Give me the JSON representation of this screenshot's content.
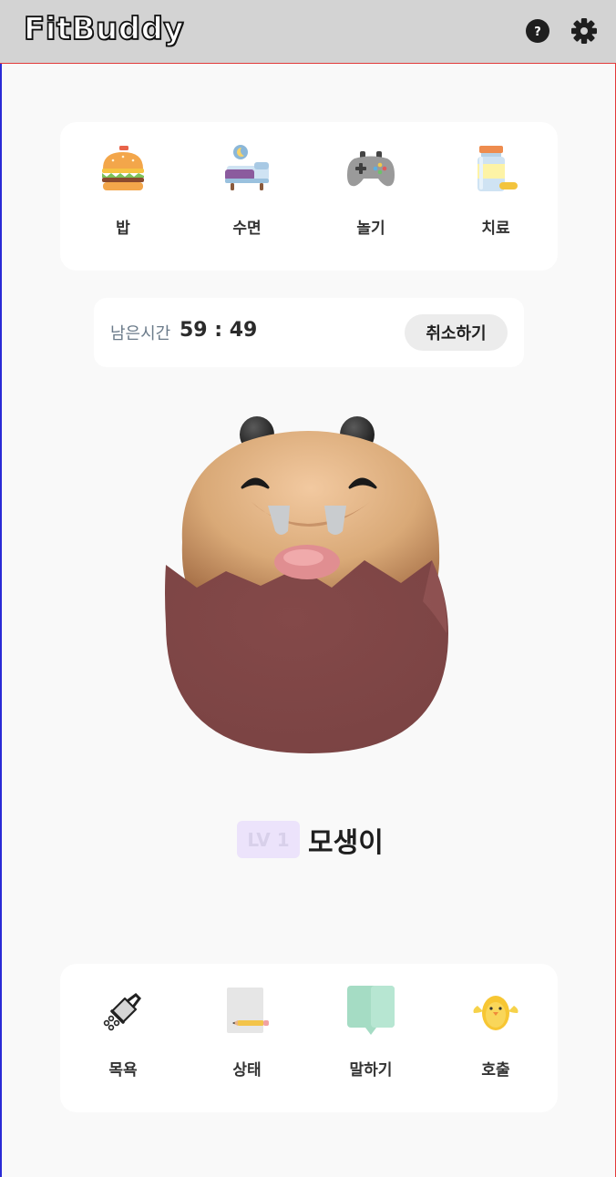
{
  "header": {
    "logo": "FitBuddy",
    "help_icon": "question-circle-icon",
    "settings_icon": "gear-icon"
  },
  "top_actions": [
    {
      "label": "밥",
      "icon": "burger-icon"
    },
    {
      "label": "수면",
      "icon": "bed-icon"
    },
    {
      "label": "놀기",
      "icon": "gamepad-icon"
    },
    {
      "label": "치료",
      "icon": "medicine-bottle-icon"
    }
  ],
  "timer": {
    "label": "남은시간",
    "value": "59 : 49",
    "cancel_label": "취소하기"
  },
  "pet": {
    "level": "LV 1",
    "name": "모생이",
    "image": "pet-character"
  },
  "bottom_actions": [
    {
      "label": "목욕",
      "icon": "shower-icon"
    },
    {
      "label": "상태",
      "icon": "notepad-pencil-icon"
    },
    {
      "label": "말하기",
      "icon": "speech-bubble-icon"
    },
    {
      "label": "호출",
      "icon": "chick-icon"
    }
  ],
  "colors": {
    "header_bg": "#d3d3d3",
    "page_bg": "#f9f9f9",
    "card_bg": "#ffffff",
    "level_badge_bg": "#ece3fb",
    "pet_body": "#7e4646",
    "pet_face": "#d7a97b"
  }
}
